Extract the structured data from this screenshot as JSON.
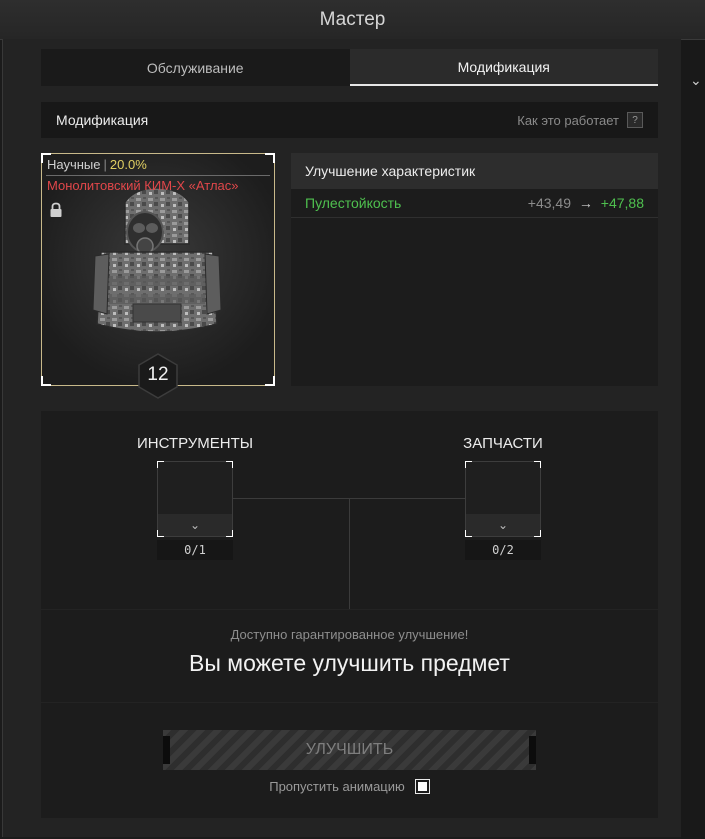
{
  "window": {
    "title": "Мастер"
  },
  "tabs": [
    {
      "label": "Обслуживание",
      "active": false
    },
    {
      "label": "Модификация",
      "active": true
    }
  ],
  "section": {
    "title": "Модификация",
    "how_it_works": "Как это работает",
    "help_glyph": "?"
  },
  "item": {
    "category": "Научные",
    "separator": "|",
    "percent": "20.0%",
    "name": "Монолитовский КИМ-Х «Атлас»",
    "level": "12",
    "locked": true,
    "icons": [
      "lock-icon",
      "armor-icon"
    ]
  },
  "stats": {
    "header": "Улучшение характеристик",
    "rows": [
      {
        "name": "Пулестойкость",
        "old": "+43,49",
        "arrow": "→",
        "new": "+47,88"
      }
    ]
  },
  "materials": {
    "tools": {
      "title": "ИНСТРУМЕНТЫ",
      "count": "0/1",
      "chevron": "⌄"
    },
    "parts": {
      "title": "ЗАПЧАСТИ",
      "count": "0/2",
      "chevron": "⌄"
    }
  },
  "status": {
    "sub": "Доступно гарантированное улучшение!",
    "main": "Вы можете улучшить предмет"
  },
  "actions": {
    "upgrade_label": "УЛУЧШИТЬ",
    "skip_animation_label": "Пропустить анимацию",
    "skip_animation_checked": true
  },
  "colors": {
    "accent_green": "#4fc04f",
    "item_name_red": "#e0474a",
    "percent_yellow": "#e0cf62",
    "card_border": "#c8b98a"
  }
}
